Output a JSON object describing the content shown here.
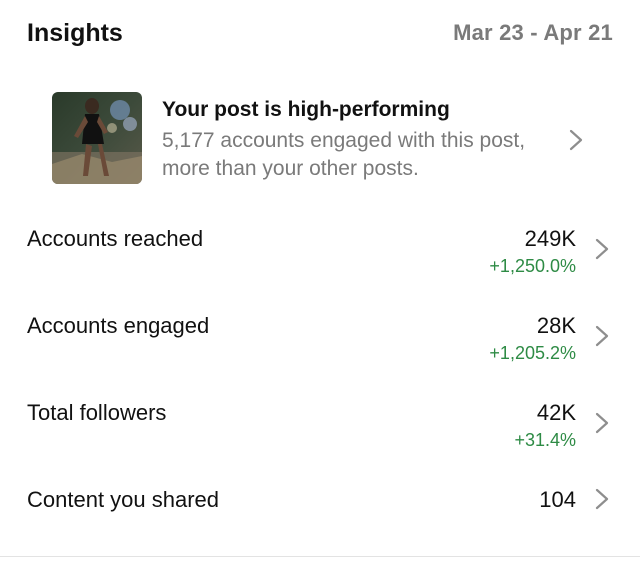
{
  "header": {
    "title": "Insights",
    "date_range": "Mar 23 - Apr 21"
  },
  "post": {
    "title": "Your post is high-performing",
    "description": "5,177 accounts engaged with this post, more than your other posts.",
    "thumbnail_icon": "post-thumbnail"
  },
  "metrics": [
    {
      "label": "Accounts reached",
      "value": "249K",
      "change": "+1,250.0%"
    },
    {
      "label": "Accounts engaged",
      "value": "28K",
      "change": "+1,205.2%"
    },
    {
      "label": "Total followers",
      "value": "42K",
      "change": "+31.4%"
    },
    {
      "label": "Content you shared",
      "value": "104",
      "change": ""
    }
  ],
  "colors": {
    "positive": "#2e8b45",
    "muted": "#7a7a7a",
    "chevron": "#8e8e8e"
  }
}
